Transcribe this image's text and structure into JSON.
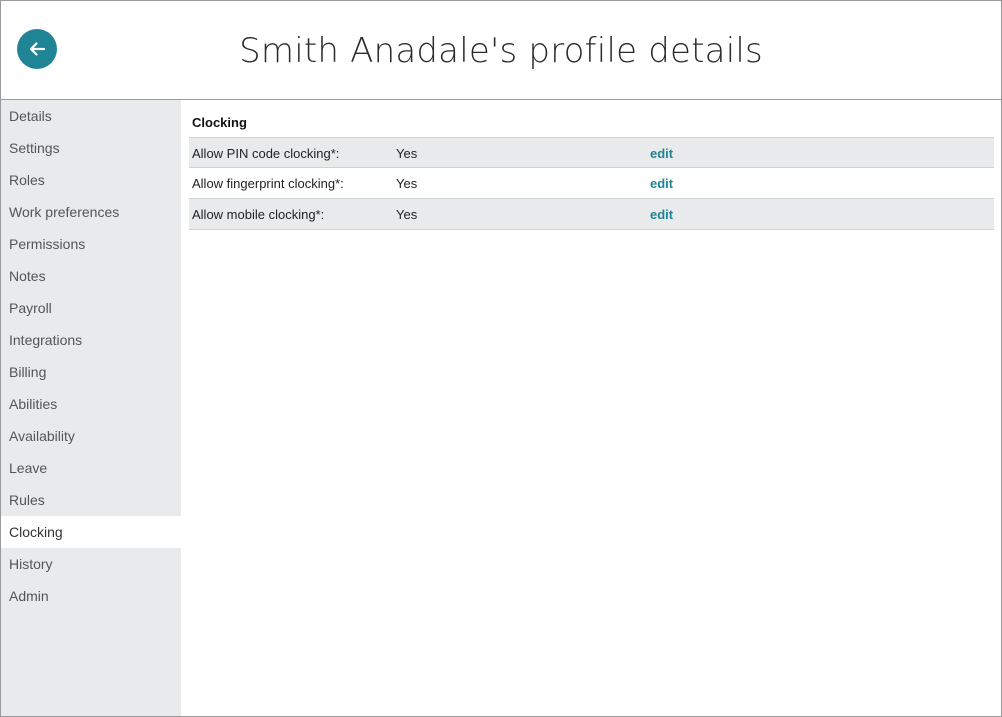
{
  "header": {
    "title": "Smith Anadale's profile details",
    "back_icon": "arrow-left-icon",
    "accent_color": "#1f8596"
  },
  "sidebar": {
    "items": [
      {
        "label": "Details"
      },
      {
        "label": "Settings"
      },
      {
        "label": "Roles"
      },
      {
        "label": "Work preferences"
      },
      {
        "label": "Permissions"
      },
      {
        "label": "Notes"
      },
      {
        "label": "Payroll"
      },
      {
        "label": "Integrations"
      },
      {
        "label": "Billing"
      },
      {
        "label": "Abilities"
      },
      {
        "label": "Availability"
      },
      {
        "label": "Leave"
      },
      {
        "label": "Rules"
      },
      {
        "label": "Clocking",
        "active": true
      },
      {
        "label": "History"
      },
      {
        "label": "Admin"
      }
    ]
  },
  "main": {
    "section_title": "Clocking",
    "rows": [
      {
        "label": "Allow PIN code clocking*:",
        "value": "Yes",
        "action": "edit"
      },
      {
        "label": "Allow fingerprint clocking*:",
        "value": "Yes",
        "action": "edit"
      },
      {
        "label": "Allow mobile clocking*:",
        "value": "Yes",
        "action": "edit"
      }
    ]
  }
}
